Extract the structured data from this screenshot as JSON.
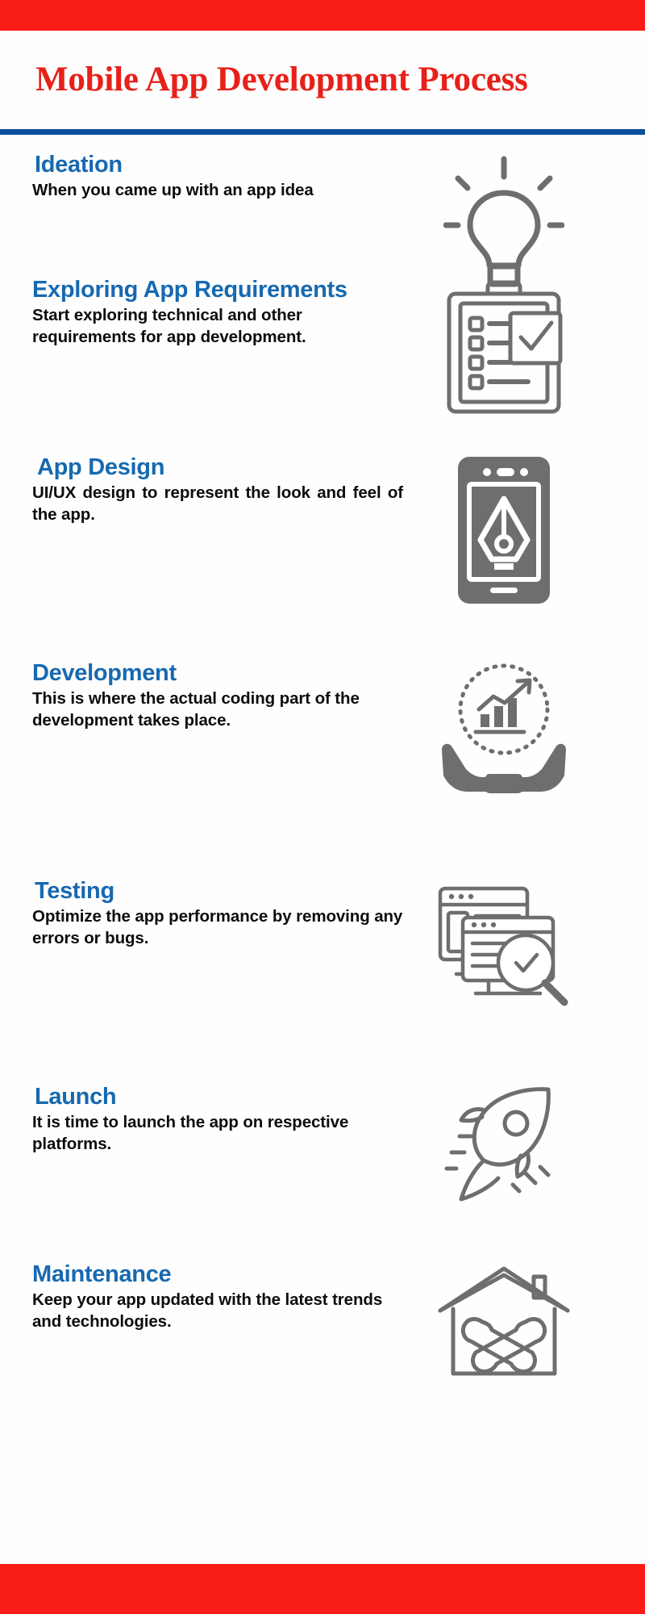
{
  "header": {
    "title": "Mobile App Development Process",
    "accent_red": "#fa1c16",
    "title_red": "#e8201a",
    "divider_blue": "#0a4e9e"
  },
  "theme": {
    "heading_blue": "#1769b0",
    "body_black": "#0d0d0d",
    "icon_gray": "#6e6e6e",
    "background": "#ffffff"
  },
  "steps": [
    {
      "heading": "Ideation",
      "body": "When you came up with an app idea",
      "icon": "lightbulb-icon"
    },
    {
      "heading": "Exploring App Requirements",
      "body": "Start exploring technical and other requirements for app development.",
      "icon": "clipboard-checklist-icon"
    },
    {
      "heading": "App Design",
      "body": "UI/UX design to represent the look and feel of the app.",
      "icon": "phone-pen-nib-icon"
    },
    {
      "heading": "Development",
      "body": "This is where the actual coding part of the development takes place.",
      "icon": "growth-chart-hands-icon"
    },
    {
      "heading": "Testing",
      "body": "Optimize the app performance by removing any errors or bugs.",
      "icon": "monitor-magnifier-icon"
    },
    {
      "heading": "Launch",
      "body": "It is time to launch the app on respective platforms.",
      "icon": "rocket-icon"
    },
    {
      "heading": "Maintenance",
      "body": "Keep your app updated with the latest trends and technologies.",
      "icon": "house-wrench-icon"
    }
  ]
}
